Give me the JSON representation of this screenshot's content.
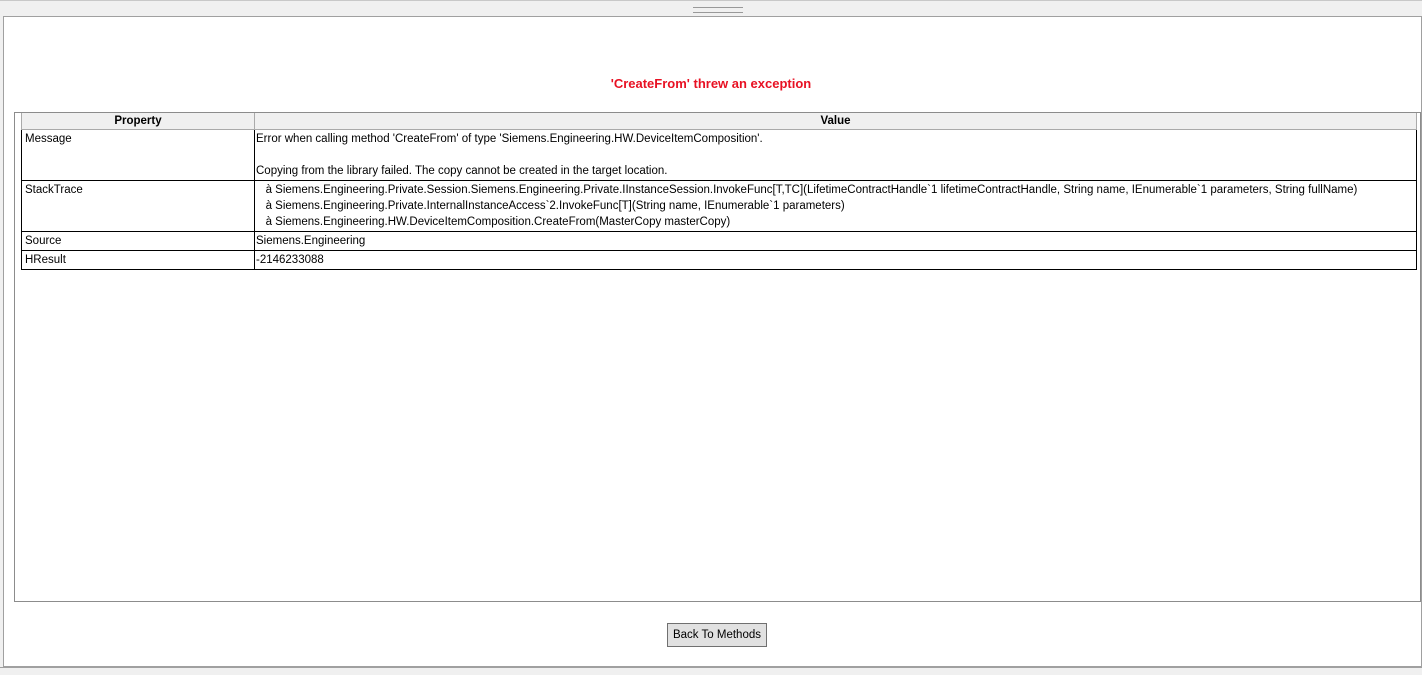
{
  "title": "'CreateFrom' threw an exception",
  "grid": {
    "headers": {
      "property": "Property",
      "value": "Value"
    },
    "rows": [
      {
        "property": "Message",
        "value": "Error when calling method 'CreateFrom' of type 'Siemens.Engineering.HW.DeviceItemComposition'.\n\nCopying from the library failed. The copy cannot be created in the target location."
      },
      {
        "property": "StackTrace",
        "value": "   à Siemens.Engineering.Private.Session.Siemens.Engineering.Private.IInstanceSession.InvokeFunc[T,TC](LifetimeContractHandle`1 lifetimeContractHandle, String name, IEnumerable`1 parameters, String fullName)\n   à Siemens.Engineering.Private.InternalInstanceAccess`2.InvokeFunc[T](String name, IEnumerable`1 parameters)\n   à Siemens.Engineering.HW.DeviceItemComposition.CreateFrom(MasterCopy masterCopy)"
      },
      {
        "property": "Source",
        "value": "Siemens.Engineering"
      },
      {
        "property": "HResult",
        "value": "-2146233088"
      }
    ]
  },
  "back_button": "Back To Methods"
}
